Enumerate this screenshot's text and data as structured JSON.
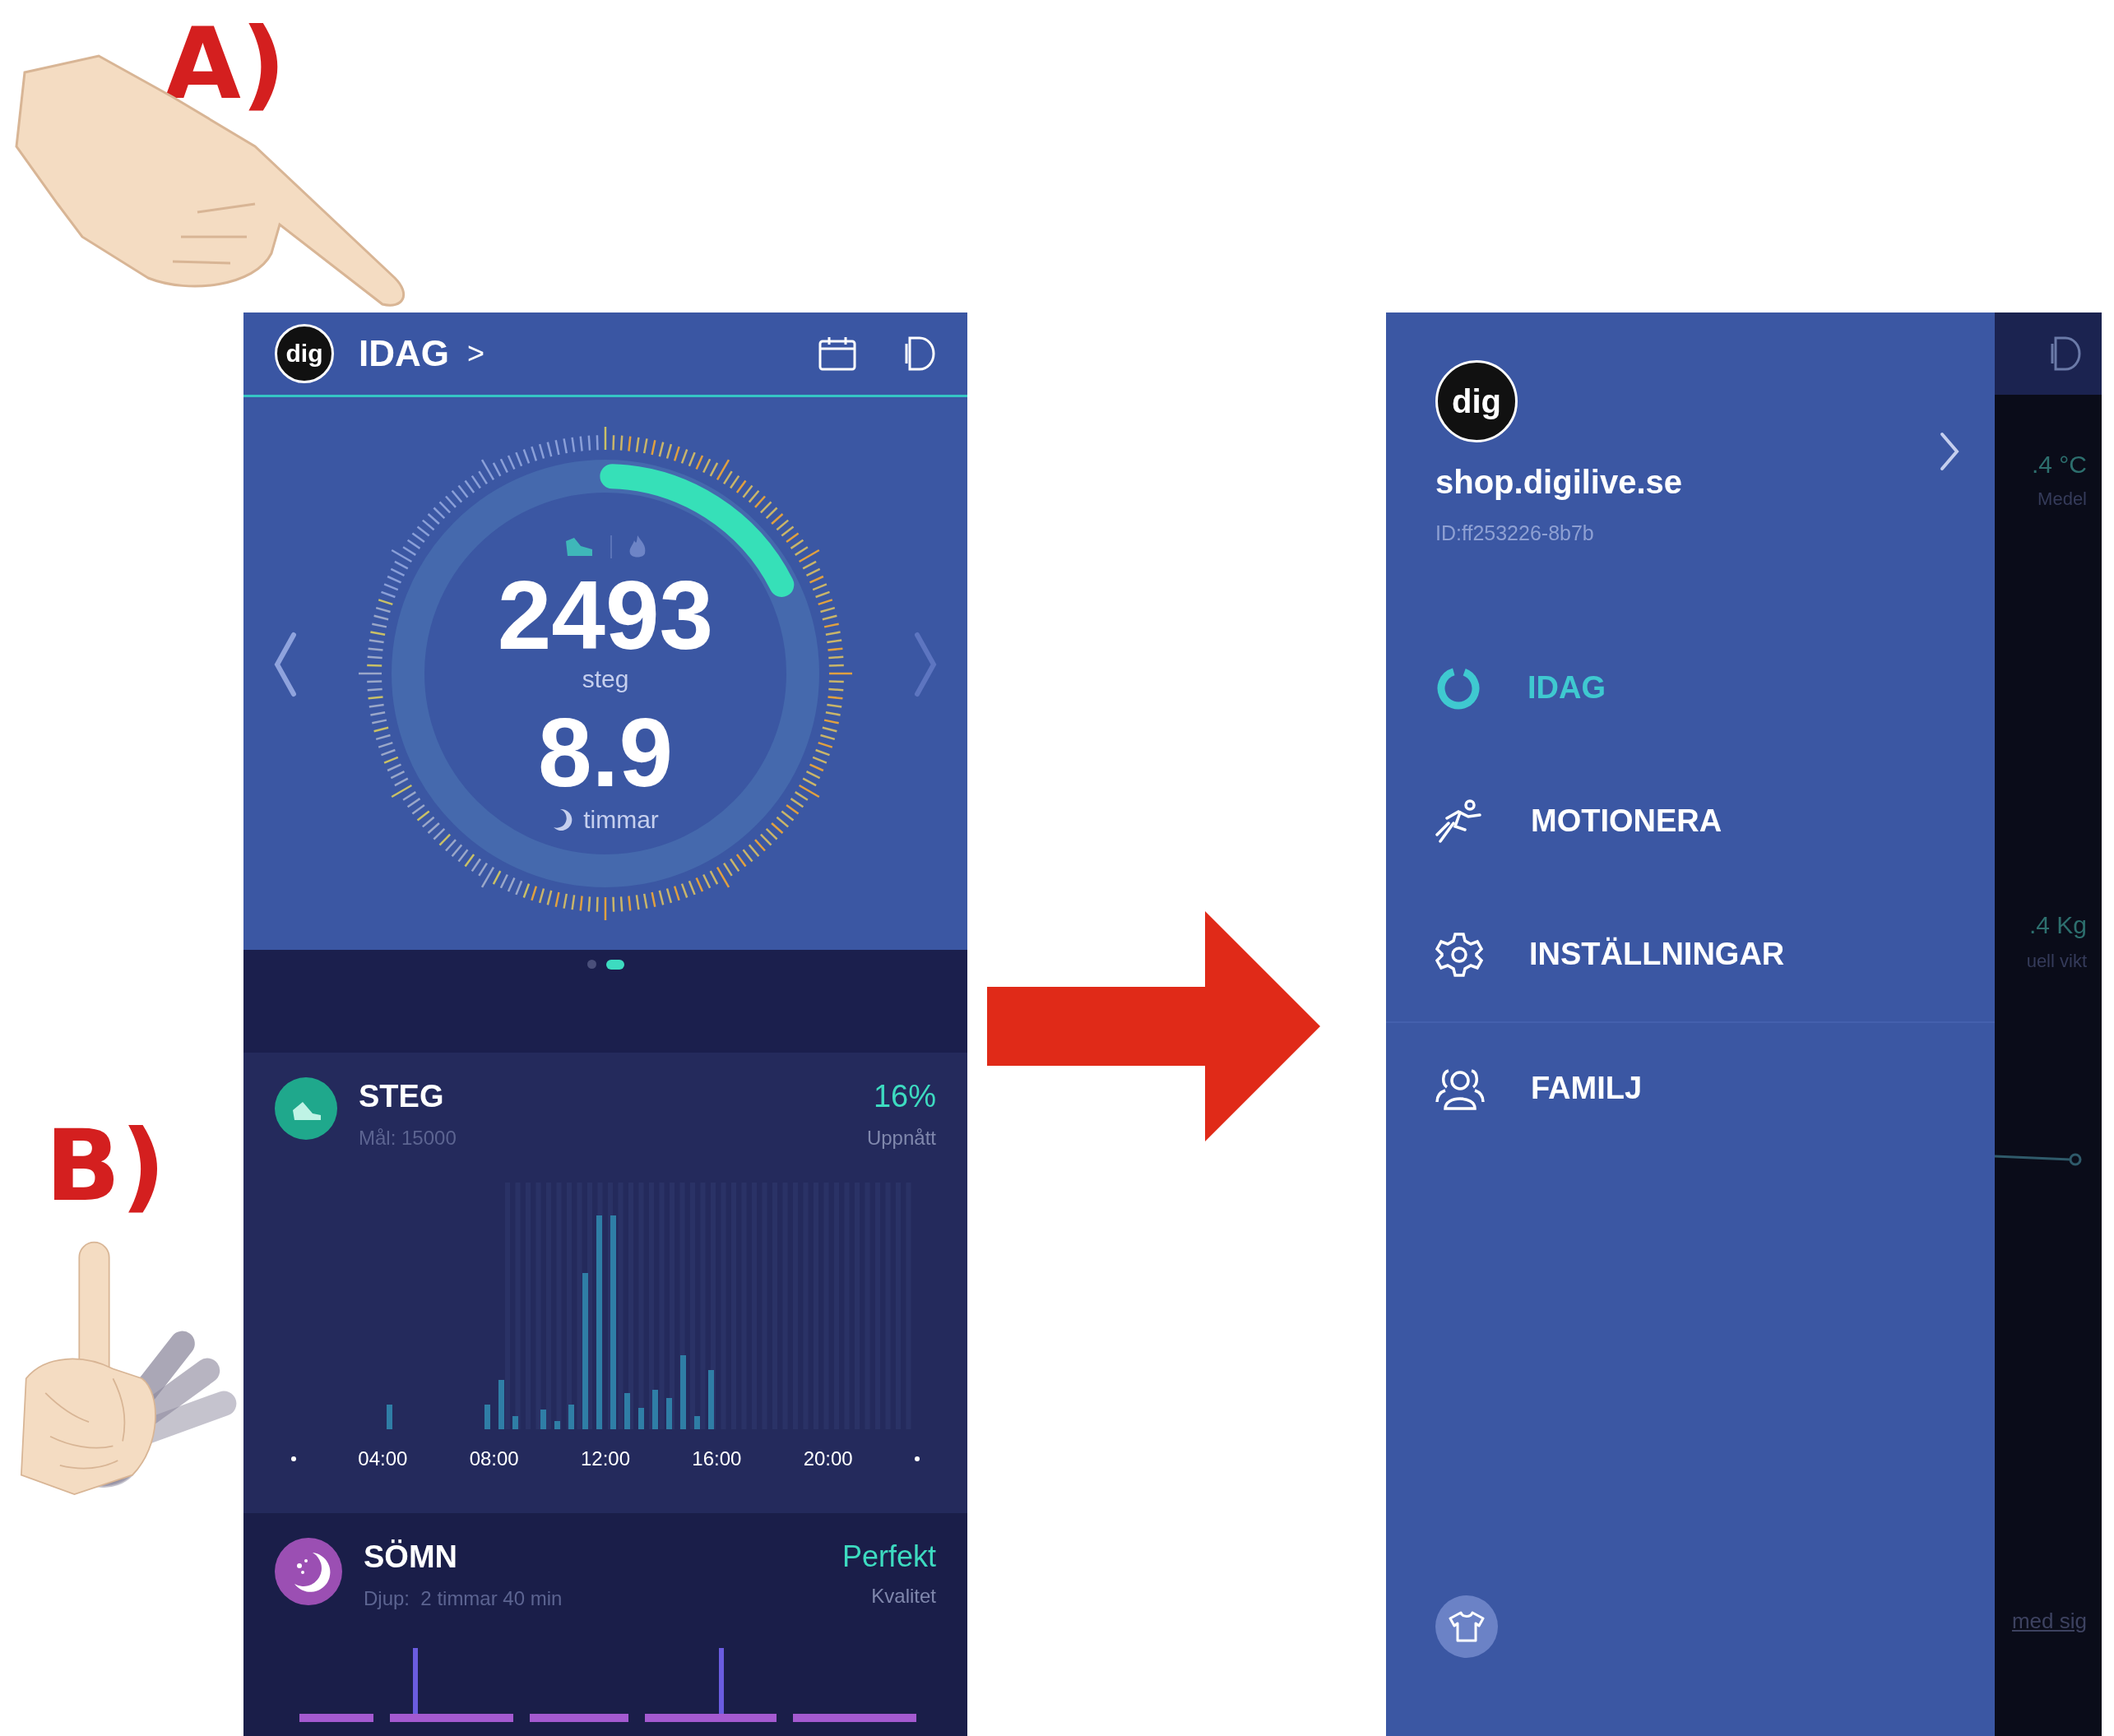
{
  "annotations": [
    {
      "label": "A)"
    },
    {
      "label": "B)"
    }
  ],
  "left_screen": {
    "header": {
      "logo": "dig",
      "title": "IDAG",
      "chevron": ">"
    },
    "dial": {
      "level": 0.17,
      "steps": "2493",
      "steps_unit": "steg",
      "sleep": "8.9",
      "sleep_unit": "timmar"
    },
    "pager": [
      {
        "selected": false
      },
      {
        "selected": true
      }
    ],
    "steps_card": {
      "title": "STEG",
      "goal": "Mål: 15000",
      "percent": "16%",
      "percent_label": "Uppnått",
      "x_labels": [
        "04:00",
        "08:00",
        "12:00",
        "16:00",
        "20:00"
      ]
    },
    "sleep_card": {
      "title": "SÖMN",
      "detail": "Djup:  2 timmar 40 min",
      "quality": "Perfekt",
      "quality_label": "Kvalitet"
    }
  },
  "right_screen": {
    "profile": {
      "logo": "dig",
      "name": "shop.digilive.se",
      "id": "ID:ff253226-8b7b"
    },
    "menu": [
      {
        "label": "IDAG",
        "kind": "ring",
        "selected": true
      },
      {
        "label": "MOTIONERA",
        "kind": "runner",
        "selected": false
      },
      {
        "label": "INSTÄLLNINGAR",
        "kind": "gear",
        "selected": false
      },
      {
        "label": "FAMILJ",
        "kind": "people",
        "selected": false
      }
    ],
    "background_texts": [
      ".4 °C",
      "Medel",
      ".4 Kg",
      "uell vikt",
      "med sig"
    ]
  }
}
